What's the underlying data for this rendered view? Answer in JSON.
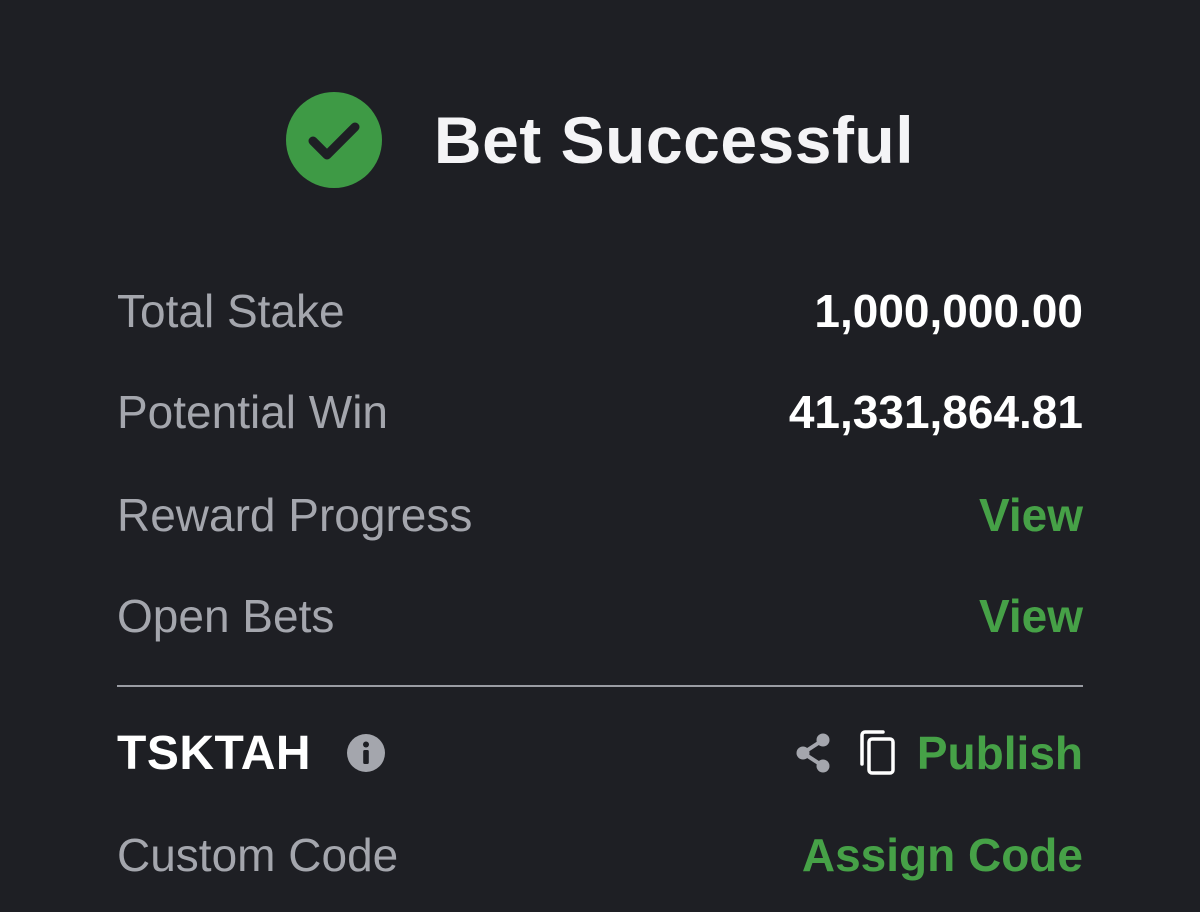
{
  "header": {
    "title": "Bet Successful",
    "icon": "check-circle-icon",
    "icon_color": "#3e9a45"
  },
  "summary": {
    "total_stake_label": "Total Stake",
    "total_stake_value": "1,000,000.00",
    "potential_win_label": "Potential Win",
    "potential_win_value": "41,331,864.81",
    "reward_progress_label": "Reward Progress",
    "reward_progress_link": "View",
    "open_bets_label": "Open Bets",
    "open_bets_link": "View"
  },
  "booking": {
    "code": "TSKTAH",
    "info_icon": "info-icon",
    "share_icon": "share-icon",
    "copy_icon": "copy-icon",
    "publish_label": "Publish",
    "custom_code_label": "Custom Code",
    "assign_code_label": "Assign Code"
  },
  "colors": {
    "background": "#1e1f24",
    "accent_green": "#46a147",
    "label_gray": "#a4a6ad"
  }
}
